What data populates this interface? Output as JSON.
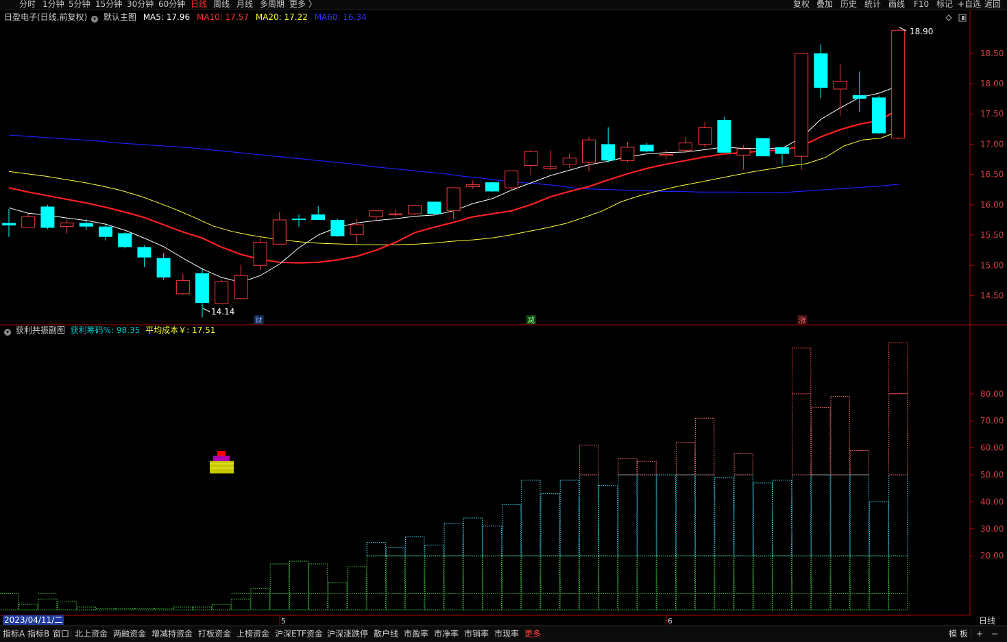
{
  "periods": [
    "分时",
    "1分钟",
    "5分钟",
    "15分钟",
    "30分钟",
    "60分钟",
    "日线",
    "周线",
    "月线",
    "多周期",
    "更多 〉"
  ],
  "active_period": "日线",
  "right_tools": [
    "复权",
    "叠加",
    "历史",
    "统计",
    "画线",
    "F10",
    "标记",
    "+自选",
    "返回"
  ],
  "main": {
    "stock_title": "日盈电子(日线,前复权)",
    "template": "默认主图",
    "ma": [
      {
        "label": "MA5: 17.96",
        "color": "#ffffff"
      },
      {
        "label": "MA10: 17.57",
        "color": "#ff3232"
      },
      {
        "label": "MA20: 17.22",
        "color": "#ffff32"
      },
      {
        "label": "MA60: 16.34",
        "color": "#3232ff"
      }
    ],
    "high_label": "18.90",
    "low_label": "14.14",
    "events": [
      "财",
      "减",
      "涨"
    ]
  },
  "sub": {
    "title": "获利共振副图",
    "profit_label": "获利筹码%: 98.35",
    "cost_label": "平均成本￥: 17.51"
  },
  "date_cursor": "2023/04/11/二",
  "month_markers": [
    "5",
    "6"
  ],
  "period_corner": "日线",
  "bottom_tabs": [
    "指标A",
    "指标B",
    "窗口",
    "北上资金",
    "两融资金",
    "增减持资金",
    "打板资金",
    "上榜资金",
    "沪深ETF资金",
    "沪深涨跌停",
    "散户线",
    "市盈率",
    "市净率",
    "市销率",
    "市现率",
    "更多"
  ],
  "bottom_right": [
    "模",
    "板",
    "+",
    "−"
  ],
  "chart_data": {
    "type": "candlestick",
    "price_axis": {
      "ylim": [
        14.2,
        18.95
      ],
      "ticks": [
        14.5,
        15.0,
        15.5,
        16.0,
        16.5,
        17.0,
        17.5,
        18.0,
        18.5
      ]
    },
    "colors": {
      "up": "#ff3c3c",
      "down": "#00ffff",
      "ma5": "#ffffff",
      "ma10": "#ff2020",
      "ma20": "#ffff40",
      "ma60": "#2020ff"
    },
    "candles": [
      {
        "o": 15.7,
        "h": 15.93,
        "l": 15.47,
        "c": 15.66
      },
      {
        "o": 15.63,
        "h": 15.85,
        "l": 15.62,
        "c": 15.8
      },
      {
        "o": 15.97,
        "h": 16.0,
        "l": 15.6,
        "c": 15.62
      },
      {
        "o": 15.64,
        "h": 15.75,
        "l": 15.52,
        "c": 15.7
      },
      {
        "o": 15.7,
        "h": 15.76,
        "l": 15.58,
        "c": 15.64
      },
      {
        "o": 15.64,
        "h": 15.67,
        "l": 15.41,
        "c": 15.47
      },
      {
        "o": 15.53,
        "h": 15.55,
        "l": 15.28,
        "c": 15.3
      },
      {
        "o": 15.3,
        "h": 15.33,
        "l": 14.97,
        "c": 15.13
      },
      {
        "o": 15.12,
        "h": 15.2,
        "l": 14.76,
        "c": 14.8
      },
      {
        "o": 14.53,
        "h": 14.86,
        "l": 14.52,
        "c": 14.75
      },
      {
        "o": 14.87,
        "h": 14.96,
        "l": 14.14,
        "c": 14.38
      },
      {
        "o": 14.37,
        "h": 14.76,
        "l": 14.37,
        "c": 14.73
      },
      {
        "o": 14.45,
        "h": 15.01,
        "l": 14.44,
        "c": 14.83
      },
      {
        "o": 15.0,
        "h": 15.46,
        "l": 14.92,
        "c": 15.38
      },
      {
        "o": 15.35,
        "h": 15.88,
        "l": 15.35,
        "c": 15.75
      },
      {
        "o": 15.77,
        "h": 15.84,
        "l": 15.64,
        "c": 15.75
      },
      {
        "o": 15.84,
        "h": 15.98,
        "l": 15.77,
        "c": 15.75
      },
      {
        "o": 15.75,
        "h": 15.77,
        "l": 15.47,
        "c": 15.48
      },
      {
        "o": 15.51,
        "h": 15.76,
        "l": 15.37,
        "c": 15.67
      },
      {
        "o": 15.8,
        "h": 15.89,
        "l": 15.75,
        "c": 15.9
      },
      {
        "o": 15.85,
        "h": 15.92,
        "l": 15.8,
        "c": 15.85
      },
      {
        "o": 15.85,
        "h": 16.0,
        "l": 15.83,
        "c": 15.99
      },
      {
        "o": 16.05,
        "h": 16.05,
        "l": 15.83,
        "c": 15.85
      },
      {
        "o": 15.9,
        "h": 16.29,
        "l": 15.76,
        "c": 16.28
      },
      {
        "o": 16.3,
        "h": 16.4,
        "l": 16.26,
        "c": 16.33
      },
      {
        "o": 16.37,
        "h": 16.38,
        "l": 16.21,
        "c": 16.22
      },
      {
        "o": 16.28,
        "h": 16.55,
        "l": 16.24,
        "c": 16.56
      },
      {
        "o": 16.65,
        "h": 16.9,
        "l": 16.49,
        "c": 16.88
      },
      {
        "o": 16.6,
        "h": 16.9,
        "l": 16.57,
        "c": 16.63
      },
      {
        "o": 16.67,
        "h": 16.85,
        "l": 16.6,
        "c": 16.77
      },
      {
        "o": 16.7,
        "h": 17.12,
        "l": 16.55,
        "c": 17.07
      },
      {
        "o": 17.0,
        "h": 17.28,
        "l": 16.7,
        "c": 16.73
      },
      {
        "o": 16.73,
        "h": 17.04,
        "l": 16.7,
        "c": 16.95
      },
      {
        "o": 16.99,
        "h": 17.02,
        "l": 16.87,
        "c": 16.88
      },
      {
        "o": 16.81,
        "h": 16.9,
        "l": 16.75,
        "c": 16.83
      },
      {
        "o": 16.9,
        "h": 17.12,
        "l": 16.87,
        "c": 17.02
      },
      {
        "o": 17.0,
        "h": 17.37,
        "l": 16.95,
        "c": 17.27
      },
      {
        "o": 17.4,
        "h": 17.45,
        "l": 16.86,
        "c": 16.86
      },
      {
        "o": 16.82,
        "h": 16.98,
        "l": 16.58,
        "c": 16.92
      },
      {
        "o": 17.1,
        "h": 17.1,
        "l": 16.8,
        "c": 16.8
      },
      {
        "o": 16.95,
        "h": 16.96,
        "l": 16.67,
        "c": 16.84
      },
      {
        "o": 16.8,
        "h": 18.5,
        "l": 16.58,
        "c": 18.5
      },
      {
        "o": 18.5,
        "h": 18.65,
        "l": 17.76,
        "c": 17.93
      },
      {
        "o": 17.91,
        "h": 18.32,
        "l": 17.47,
        "c": 18.04
      },
      {
        "o": 17.81,
        "h": 18.2,
        "l": 17.53,
        "c": 17.75
      },
      {
        "o": 17.77,
        "h": 17.8,
        "l": 17.17,
        "c": 17.18
      },
      {
        "o": 17.1,
        "h": 18.9,
        "l": 17.08,
        "c": 18.88
      }
    ],
    "ma5": [
      15.95,
      15.86,
      15.83,
      15.78,
      15.74,
      15.68,
      15.58,
      15.45,
      15.31,
      15.12,
      14.94,
      14.8,
      14.72,
      14.83,
      15.02,
      15.29,
      15.5,
      15.63,
      15.7,
      15.74,
      15.77,
      15.81,
      15.83,
      15.9,
      16.02,
      16.1,
      16.24,
      16.36,
      16.48,
      16.57,
      16.66,
      16.72,
      16.79,
      16.84,
      16.86,
      16.87,
      16.91,
      16.95,
      16.93,
      16.93,
      16.93,
      17.11,
      17.41,
      17.6,
      17.77,
      17.84,
      17.96
    ],
    "ma10": [
      16.28,
      16.21,
      16.15,
      16.09,
      16.03,
      15.96,
      15.88,
      15.79,
      15.67,
      15.55,
      15.45,
      15.3,
      15.18,
      15.1,
      15.05,
      15.04,
      15.05,
      15.09,
      15.15,
      15.25,
      15.38,
      15.54,
      15.63,
      15.71,
      15.8,
      15.85,
      15.9,
      16.0,
      16.13,
      16.22,
      16.3,
      16.41,
      16.51,
      16.6,
      16.67,
      16.73,
      16.79,
      16.84,
      16.86,
      16.89,
      16.9,
      16.97,
      17.12,
      17.24,
      17.33,
      17.39,
      17.57
    ],
    "ma20": [
      16.55,
      16.51,
      16.47,
      16.42,
      16.37,
      16.31,
      16.24,
      16.15,
      16.04,
      15.92,
      15.79,
      15.65,
      15.56,
      15.5,
      15.45,
      15.41,
      15.38,
      15.36,
      15.35,
      15.34,
      15.34,
      15.34,
      15.35,
      15.37,
      15.4,
      15.42,
      15.45,
      15.5,
      15.56,
      15.62,
      15.69,
      15.79,
      15.9,
      16.05,
      16.15,
      16.23,
      16.3,
      16.36,
      16.42,
      16.48,
      16.54,
      16.59,
      16.64,
      16.68,
      16.78,
      16.97,
      17.07,
      17.1,
      17.22
    ],
    "ma60": [
      17.15,
      17.13,
      17.11,
      17.09,
      17.07,
      17.05,
      17.02,
      17.0,
      16.98,
      16.96,
      16.94,
      16.91,
      16.88,
      16.85,
      16.82,
      16.79,
      16.76,
      16.73,
      16.7,
      16.67,
      16.63,
      16.6,
      16.57,
      16.54,
      16.51,
      16.47,
      16.44,
      16.4,
      16.37,
      16.35,
      16.32,
      16.28,
      16.26,
      16.25,
      16.24,
      16.23,
      16.22,
      16.22,
      16.21,
      16.21,
      16.21,
      16.2,
      16.2,
      16.21,
      16.23,
      16.25,
      16.27,
      16.29,
      16.31,
      16.34
    ],
    "profit_axis": {
      "ylim": [
        0,
        100
      ],
      "ticks": [
        20,
        30,
        40,
        50,
        60,
        70,
        80
      ]
    },
    "profit": [
      6,
      2,
      4,
      3,
      1,
      0.5,
      0.5,
      0.5,
      0.5,
      1,
      1,
      2,
      4,
      8,
      17,
      18,
      17,
      10,
      16,
      25,
      23,
      27,
      24,
      32,
      34,
      31,
      39,
      48,
      43,
      48,
      61,
      46,
      56,
      55,
      50,
      62,
      71,
      49,
      58,
      47,
      48,
      97,
      75,
      79,
      59,
      40,
      99
    ]
  }
}
